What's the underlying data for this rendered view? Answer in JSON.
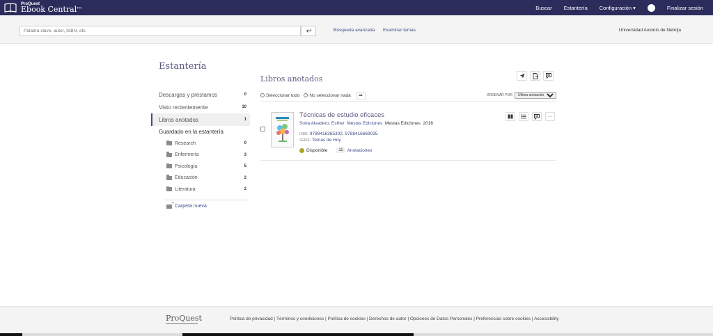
{
  "header": {
    "brand_top": "ProQuest",
    "brand_main": "Ebook Central",
    "brand_mark": "TM",
    "nav": [
      "Buscar",
      "Estantería",
      "Configuración",
      "Finalizar sesión"
    ],
    "help": "?"
  },
  "search": {
    "placeholder": "Palabra clave, autor, ISBN, etc.",
    "advanced": "Búsqueda avanzada",
    "browse": "Examinar temas",
    "institution": "Universidad Antonio de Nebrija"
  },
  "sidebar": {
    "title": "Estantería",
    "items": [
      {
        "label": "Descargas y préstamos",
        "count": "0"
      },
      {
        "label": "Visto recientemente",
        "count": "10"
      },
      {
        "label": "Libros anotados",
        "count": "1"
      }
    ],
    "saved_header": "Guardado en la estantería",
    "folders": [
      {
        "label": "Research",
        "count": "0"
      },
      {
        "label": "Enfermería",
        "count": "3"
      },
      {
        "label": "Psicología",
        "count": "5"
      },
      {
        "label": "Educación",
        "count": "2"
      },
      {
        "label": "Literatura",
        "count": "2"
      }
    ],
    "new_folder": "Carpeta nueva"
  },
  "main": {
    "title": "Libros anotados",
    "select_all": "Seleccionar todo",
    "select_none": "No seleccionar nada",
    "sort_label": "ORDENAR POR",
    "sort_value": "Última anotación"
  },
  "book": {
    "title": "Técnicas de estudio eficaces",
    "author": "Soria Alvadero, Esther",
    "publisher1": "Mestas Ediciones",
    "publisher2": "Mestas Ediciones",
    "year": "2016",
    "isbn_label": "ISBN:",
    "isbn": "9788416365302, 9788416669035",
    "serie_label": "SERIE:",
    "serie": "Temas de Hoy",
    "status": "Disponible",
    "annotations_count": "11",
    "annotations_label": "Anotaciones",
    "more": "···"
  },
  "footer": {
    "logo": "ProQuest",
    "links": "Política de privacidad | Términos y condiciones | Política de cookies | Derechos de autor | Opciones de Datos Personales | Preferencias sobre cookies | Accessibility"
  },
  "colors": {
    "nav_bg": "#2b2b5c",
    "accent": "#3d4d88",
    "available_dot": "#a8a822"
  }
}
